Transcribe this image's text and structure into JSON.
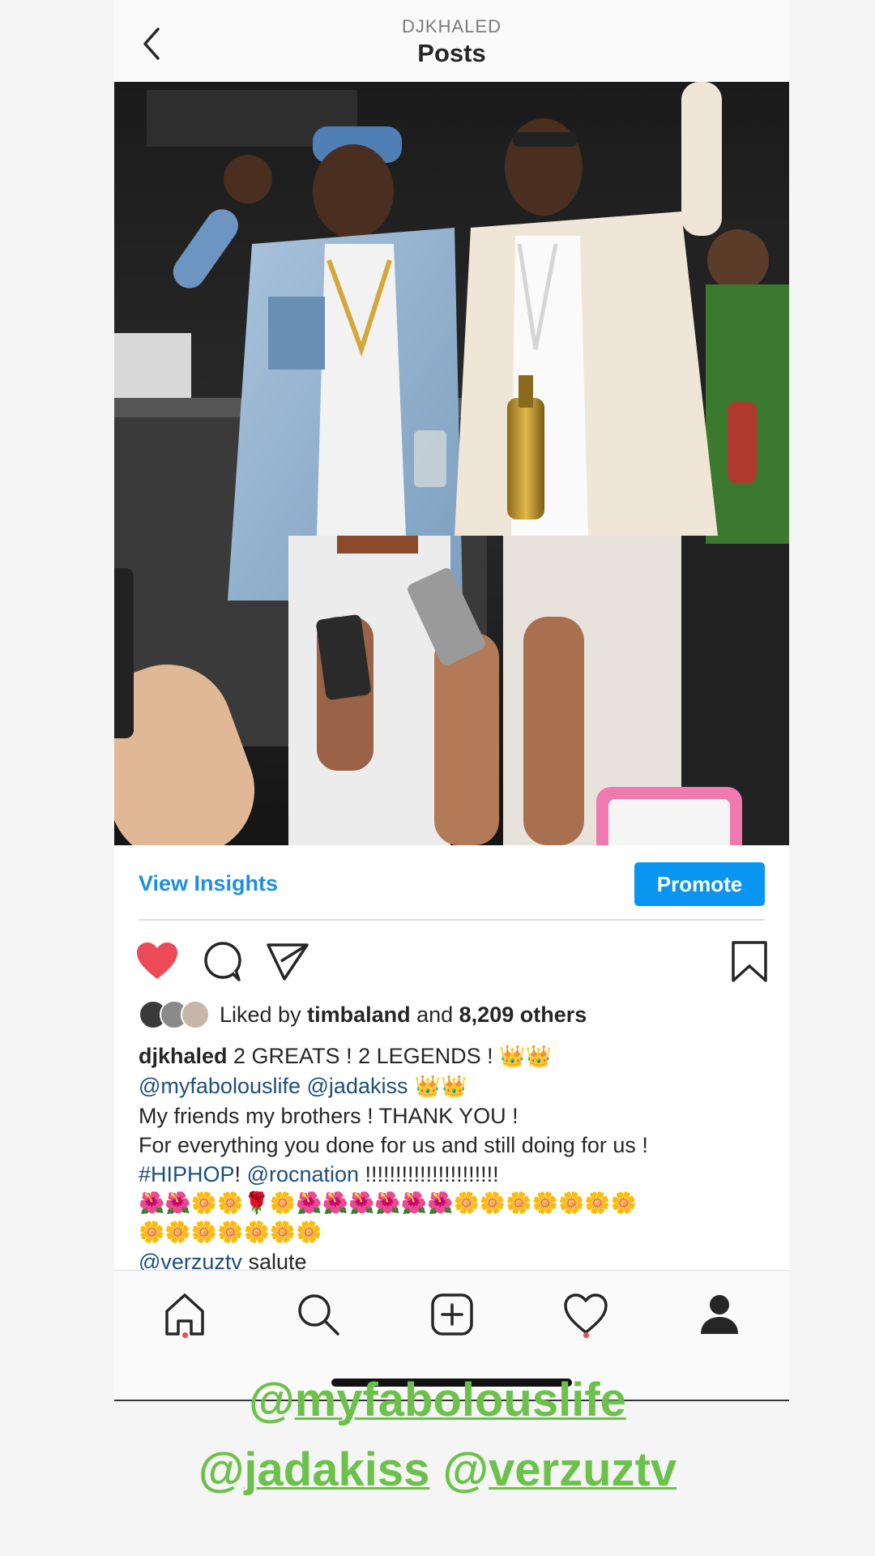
{
  "header": {
    "username": "DJKHALED",
    "title": "Posts"
  },
  "post_bar": {
    "view_insights": "View Insights",
    "promote": "Promote"
  },
  "likes": {
    "prefix": "Liked by ",
    "user": "timbaland",
    "middle": " and ",
    "count": "8,209 others"
  },
  "caption": {
    "username": "djkhaled",
    "line1_text": " 2 GREATS ! 2 LEGENDS ! ",
    "line1_emoji": "👑👑",
    "mention1": "@myfabolouslife",
    "mention2": "@jadakiss",
    "line2_emoji": " 👑👑",
    "line3": "My friends my brothers ! THANK YOU !",
    "line4": "For everything you done for us and still doing for us !",
    "hashtag": "#HIPHOP",
    "bang": "! ",
    "mention3": "@rocnation",
    "exclaims": " !!!!!!!!!!!!!!!!!!!!!!",
    "emoji_row1": "🌺🌺🌼🌼🌹🌼🌺🌺🌺🌺🌺🌺🌼🌼🌼🌼🌼🌼🌼",
    "emoji_row2": "🌼🌼🌼🌼🌼🌼🌼",
    "mention4": "@verzuztv",
    "salute": " salute"
  },
  "overlay": {
    "at1": "@",
    "tag1": "myfabolouslife",
    "at2": "@",
    "tag2": "jadakiss",
    "at3": " @",
    "tag3": "verzuztv"
  },
  "icons": {
    "back": "chevron-left-icon",
    "like": "heart-filled-icon",
    "comment": "comment-icon",
    "share": "send-icon",
    "save": "bookmark-icon",
    "nav": [
      "home-icon",
      "search-icon",
      "add-icon",
      "activity-icon",
      "profile-icon"
    ]
  },
  "colors": {
    "accent": "#0a95f1",
    "link": "#1d8fe0",
    "mention": "#1d4f7c",
    "like": "#ed4956",
    "overlay_text": "#6cc14a"
  }
}
